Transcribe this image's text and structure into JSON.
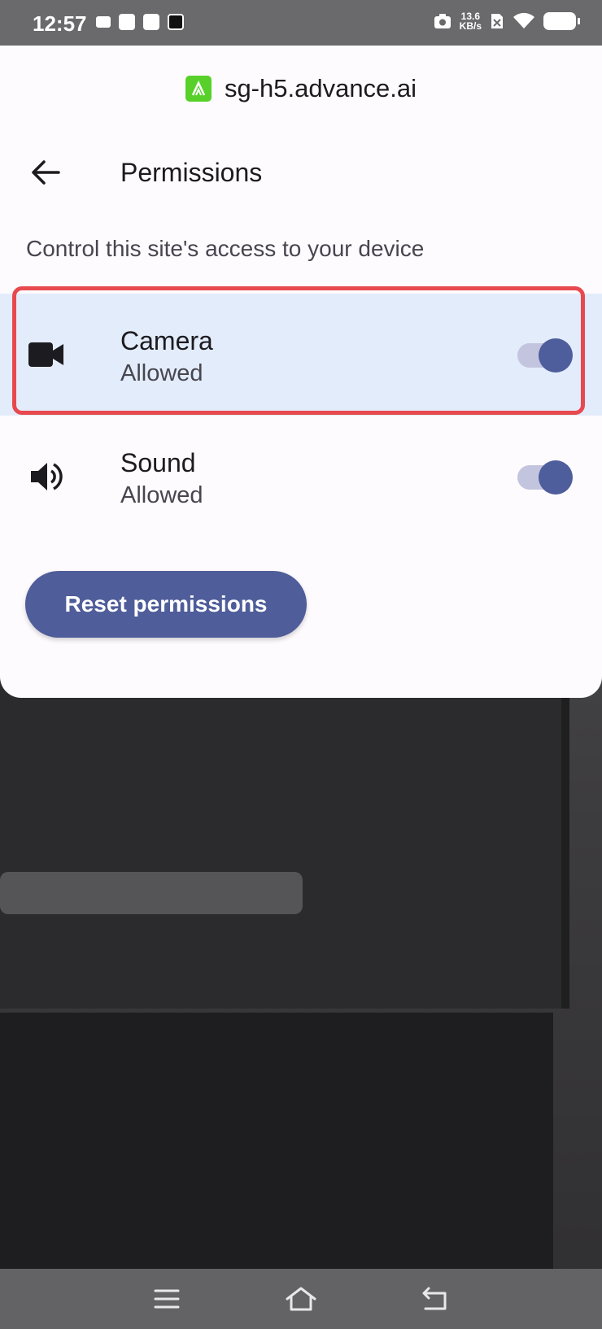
{
  "status_bar": {
    "time": "12:57",
    "net_speed_value": "13.6",
    "net_speed_unit": "KB/s"
  },
  "site": {
    "url": "sg-h5.advance.ai",
    "logo_color": "#57d12a"
  },
  "header": {
    "title": "Permissions"
  },
  "subtitle": "Control this site's access to your device",
  "permissions": [
    {
      "name": "Camera",
      "status": "Allowed",
      "icon": "videocam-icon",
      "enabled": true,
      "highlighted": true
    },
    {
      "name": "Sound",
      "status": "Allowed",
      "icon": "volume-icon",
      "enabled": true,
      "highlighted": false
    }
  ],
  "reset_button": {
    "label": "Reset permissions"
  },
  "colors": {
    "accent": "#4f5d9a",
    "highlight_border": "#e8494f",
    "selected_row_bg": "#e3ecfb",
    "sheet_bg": "#fefbfe"
  }
}
